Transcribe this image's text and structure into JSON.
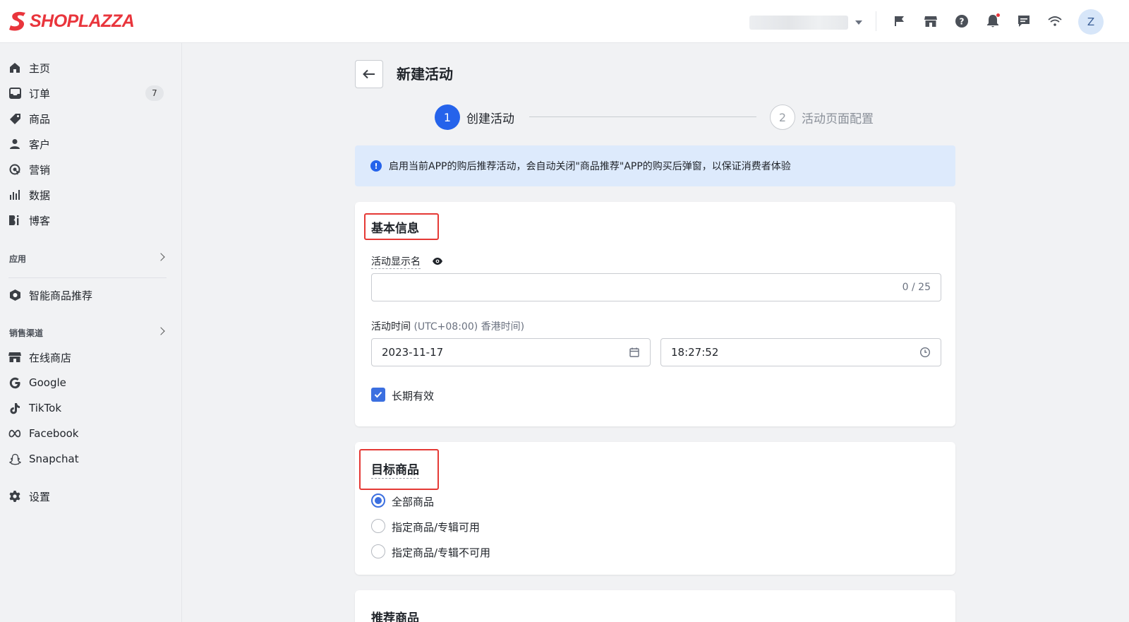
{
  "brand": {
    "name": "SHOPLAZZA",
    "color": "#e9353c"
  },
  "topbar": {
    "icons": [
      "flag-icon",
      "store-icon",
      "help-icon",
      "bell-icon",
      "chat-icon",
      "wifi-icon"
    ],
    "avatar_initial": "Z"
  },
  "sidebar": {
    "items": [
      {
        "label": "主页",
        "icon": "home-icon"
      },
      {
        "label": "订单",
        "icon": "inbox-icon",
        "badge": "7"
      },
      {
        "label": "商品",
        "icon": "tag-icon"
      },
      {
        "label": "客户",
        "icon": "person-icon"
      },
      {
        "label": "营销",
        "icon": "target-icon"
      },
      {
        "label": "数据",
        "icon": "bar-chart-icon"
      },
      {
        "label": "博客",
        "icon": "blog-icon"
      }
    ],
    "apps_heading": "应用",
    "apps": [
      {
        "label": "智能商品推荐",
        "icon": "app-hexagon-icon"
      }
    ],
    "channels_heading": "销售渠道",
    "channels": [
      {
        "label": "在线商店",
        "icon": "store-icon"
      },
      {
        "label": "Google",
        "icon": "google-icon"
      },
      {
        "label": "TikTok",
        "icon": "tiktok-icon"
      },
      {
        "label": "Facebook",
        "icon": "meta-icon"
      },
      {
        "label": "Snapchat",
        "icon": "snapchat-icon"
      }
    ],
    "settings": {
      "label": "设置",
      "icon": "gear-icon"
    }
  },
  "main": {
    "title": "新建活动",
    "steps": [
      {
        "number": "1",
        "label": "创建活动",
        "active": true
      },
      {
        "number": "2",
        "label": "活动页面配置",
        "active": false
      }
    ],
    "alert": "启用当前APP的购后推荐活动，会自动关闭\"商品推荐\"APP的购买后弹窗，以保证消费者体验",
    "basic_info": {
      "title": "基本信息",
      "display_name_label": "活动显示名",
      "display_name_value": "",
      "display_name_counter": "0 / 25",
      "time_label": "活动时间",
      "time_zone": "(UTC+08:00) 香港时间)",
      "date_value": "2023-11-17",
      "time_value": "18:27:52",
      "long_term_label": "长期有效",
      "long_term_checked": true
    },
    "target": {
      "title": "目标商品",
      "options": [
        "全部商品",
        "指定商品/专辑可用",
        "指定商品/专辑不可用"
      ],
      "selected_index": 0
    },
    "recommend": {
      "title": "推荐商品"
    }
  },
  "colors": {
    "accent": "#2563eb",
    "highlight": "#e53935",
    "alert_bg": "#ddeafc"
  }
}
